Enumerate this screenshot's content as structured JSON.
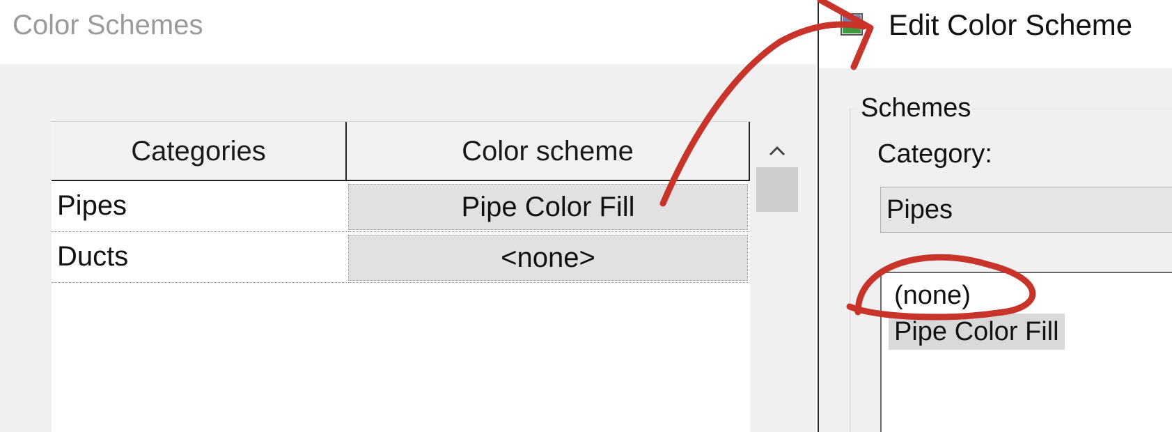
{
  "left_dialog": {
    "title": "Color Schemes",
    "table": {
      "columns": [
        "Categories",
        "Color scheme"
      ],
      "rows": [
        {
          "category": "Pipes",
          "scheme": "Pipe Color Fill"
        },
        {
          "category": "Ducts",
          "scheme": "<none>"
        }
      ]
    }
  },
  "right_dialog": {
    "title": "Edit Color Scheme",
    "schemes_group": {
      "label": "Schemes",
      "category_label": "Category:",
      "category_value": "Pipes",
      "list_items": [
        "(none)",
        "Pipe Color Fill"
      ]
    }
  },
  "colors": {
    "annotation": "#c8342a",
    "selected_item_bg": "#d9d9d9",
    "dialog_bg": "#f0f0f0"
  },
  "icons": {
    "app_icon": "edit-color-scheme-icon",
    "scroll_up": "chevron-up-icon"
  }
}
